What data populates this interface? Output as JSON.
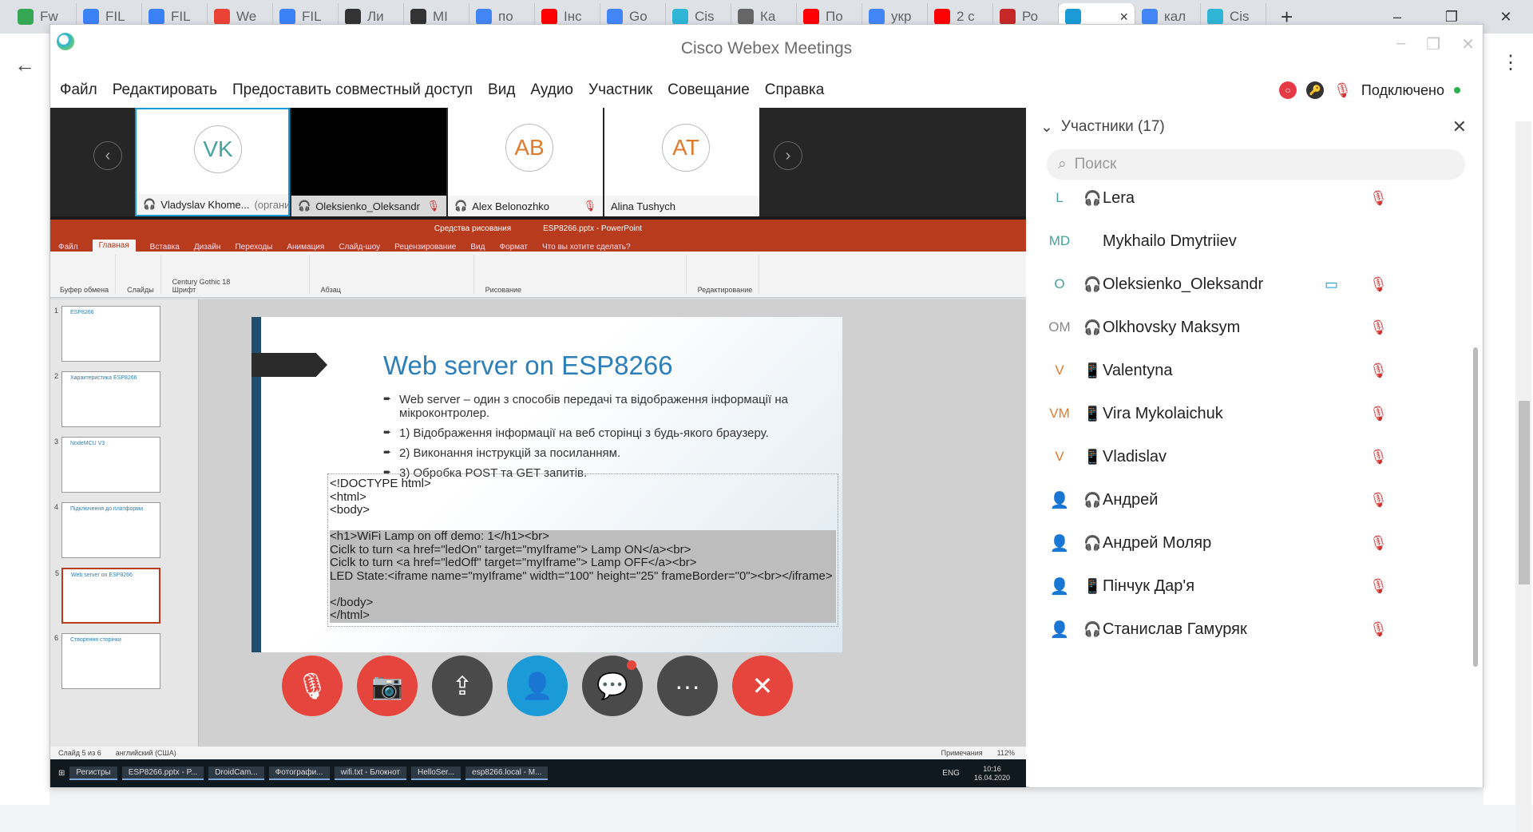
{
  "browser": {
    "tabs": [
      {
        "label": "Fw",
        "color": "#34a853"
      },
      {
        "label": "FIL",
        "color": "#3b82f6"
      },
      {
        "label": "FIL",
        "color": "#3b82f6"
      },
      {
        "label": "We",
        "color": "#ea4335"
      },
      {
        "label": "FIL",
        "color": "#3b82f6"
      },
      {
        "label": "Ли",
        "color": "#333333"
      },
      {
        "label": "MI",
        "color": "#333333"
      },
      {
        "label": "по",
        "color": "#4285f4"
      },
      {
        "label": "Інс",
        "color": "#ff0000"
      },
      {
        "label": "Go",
        "color": "#4285f4"
      },
      {
        "label": "Cis",
        "color": "#2fb5d6"
      },
      {
        "label": "Ка",
        "color": "#666666"
      },
      {
        "label": "По",
        "color": "#ff0000"
      },
      {
        "label": "укр",
        "color": "#4285f4"
      },
      {
        "label": "2 с",
        "color": "#ff0000"
      },
      {
        "label": "Ро",
        "color": "#c62828"
      },
      {
        "label": "",
        "color": "#1a9bd7",
        "active": true
      },
      {
        "label": "кал",
        "color": "#4285f4"
      },
      {
        "label": "Cis",
        "color": "#2fb5d6"
      }
    ],
    "close_glyph": "×",
    "new_tab_glyph": "+",
    "win_controls": [
      "–",
      "❐",
      "✕"
    ],
    "back_glyph": "←",
    "menu_glyph": "⋮"
  },
  "webex": {
    "title": "Cisco Webex Meetings",
    "menu": [
      "Файл",
      "Редактировать",
      "Предоставить совместный доступ",
      "Вид",
      "Аудио",
      "Участник",
      "Совещание",
      "Справка"
    ],
    "status": "Подключено",
    "status_red_badge": "○",
    "status_key_glyph": "🔑",
    "filmstrip": {
      "prev": "‹",
      "next": "›",
      "tiles": [
        {
          "initials": "VK",
          "name": "Vladyslav Khome...",
          "role": "(организатор)",
          "muted": false
        },
        {
          "initials": "",
          "name": "Oleksienko_Oleksandr",
          "role": "",
          "muted": true
        },
        {
          "initials": "AB",
          "name": "Alex Belonozhko",
          "role": "",
          "muted": true
        },
        {
          "initials": "AT",
          "name": "Alina Tushych",
          "role": "",
          "muted": false
        }
      ]
    },
    "controls": {
      "mute": "🎙",
      "video": "📷",
      "share": "⇪",
      "participants": "👤",
      "chat": "💬",
      "more": "···",
      "leave": "✕"
    }
  },
  "powerpoint": {
    "title_context": "Средства рисования",
    "title_file": "ESP8266.pptx - PowerPoint",
    "tabs": [
      "Файл",
      "Главная",
      "Вставка",
      "Дизайн",
      "Переходы",
      "Анимация",
      "Слайд-шоу",
      "Рецензирование",
      "Вид",
      "Формат",
      "Что вы хотите сделать?"
    ],
    "ribbon_groups": [
      "Буфер обмена",
      "Слайды",
      "Шрифт",
      "Абзац",
      "Рисование",
      "Редактирование"
    ],
    "font_name": "Century Gothic",
    "font_size": "18",
    "thumbnails": [
      {
        "num": "1",
        "title": "ESP8266"
      },
      {
        "num": "2",
        "title": "Характеристика ESP8266"
      },
      {
        "num": "3",
        "title": "NodeMCU V3"
      },
      {
        "num": "4",
        "title": "Підключення до платформи"
      },
      {
        "num": "5",
        "title": "Web server on ESP8266"
      },
      {
        "num": "6",
        "title": "Створення сторінки"
      }
    ],
    "slide": {
      "heading": "Web server on ESP8266",
      "bullets": [
        "Web server – один з способів передачі та відображення інформації на мікроконтролер.",
        "1) Відображення інформації на веб сторінці з будь-якого браузеру.",
        "2) Виконання інструкцій за посиланням.",
        "3) Обробка POST та GET запитів."
      ],
      "code": [
        "<!DOCTYPE html>",
        "<html>",
        "<body>",
        "",
        "<h1>WiFi Lamp on off demo: 1</h1><br>",
        "Ciclk to turn <a href=\"ledOn\" target=\"myIframe\"> Lamp ON</a><br>",
        "Ciclk to turn <a href=\"ledOff\" target=\"myIframe\"> Lamp OFF</a><br>",
        "LED State:<iframe name=\"myIframe\" width=\"100\" height=\"25\" frameBorder=\"0\"><br></iframe>",
        "",
        "</body>",
        "</html>"
      ]
    },
    "status_slide": "Слайд 5 из 6",
    "status_lang": "английский (США)",
    "status_notes": "Примечания",
    "zoom": "112%",
    "taskbar": [
      "Регистры",
      "ESP8266.pptx - P...",
      "DroidCam...",
      "Фотографи...",
      "wifi.txt - Блокнот",
      "HelloSer...",
      "esp8266.local - M..."
    ],
    "clock_time": "10:16",
    "clock_date": "16.04.2020",
    "tray_lang": "ENG"
  },
  "participants_panel": {
    "title": "Участники (17)",
    "search_placeholder": "Поиск",
    "list": [
      {
        "initials": "L",
        "name": "Lera",
        "device": "headset",
        "cam": false,
        "muted": true,
        "color": "teal"
      },
      {
        "initials": "MD",
        "name": "Mykhailo Dmytriiev",
        "device": "none",
        "cam": false,
        "muted": false,
        "color": "teal"
      },
      {
        "initials": "O",
        "name": "Oleksienko_Oleksandr",
        "device": "headset",
        "cam": true,
        "muted": true,
        "color": "teal"
      },
      {
        "initials": "OM",
        "name": "Olkhovsky Maksym",
        "device": "headset",
        "cam": false,
        "muted": true,
        "color": "gray"
      },
      {
        "initials": "V",
        "name": "Valentyna",
        "device": "phone",
        "cam": false,
        "muted": true,
        "color": "orange"
      },
      {
        "initials": "VM",
        "name": "Vira Mykolaichuk",
        "device": "phone",
        "cam": false,
        "muted": true,
        "color": "orange"
      },
      {
        "initials": "V",
        "name": "Vladislav",
        "device": "phone",
        "cam": false,
        "muted": true,
        "color": "orange"
      },
      {
        "initials": "",
        "name": "Андрей",
        "device": "headset",
        "cam": false,
        "muted": true,
        "color": "person"
      },
      {
        "initials": "",
        "name": "Андрей Моляр",
        "device": "headset",
        "cam": false,
        "muted": true,
        "color": "person"
      },
      {
        "initials": "",
        "name": "Пінчук Дар'я",
        "device": "phone",
        "cam": false,
        "muted": true,
        "color": "person"
      },
      {
        "initials": "",
        "name": "Станислав Гамуряк",
        "device": "headset",
        "cam": false,
        "muted": true,
        "color": "person"
      }
    ]
  }
}
